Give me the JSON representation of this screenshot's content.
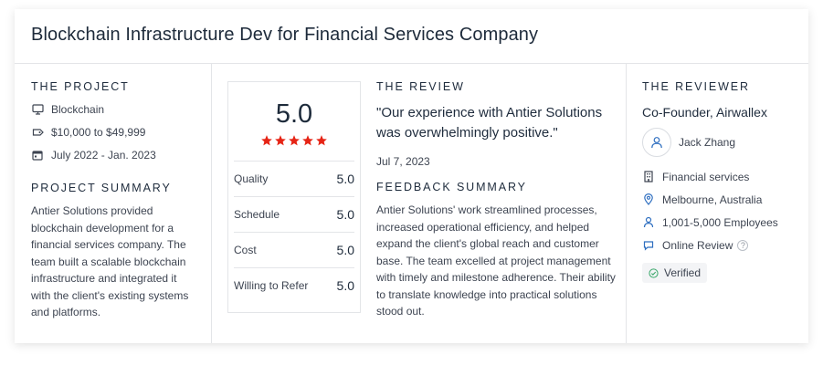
{
  "title": "Blockchain Infrastructure Dev for Financial Services Company",
  "project": {
    "heading": "THE PROJECT",
    "category": "Blockchain",
    "budget": "$10,000 to $49,999",
    "dates": "July 2022 - Jan. 2023",
    "summary_heading": "PROJECT SUMMARY",
    "summary": "Antier Solutions provided blockchain development for a financial services company. The team built a scalable blockchain infrastructure and integrated it with the client's existing systems and platforms."
  },
  "ratings": {
    "overall": "5.0",
    "stars": 5,
    "rows": [
      {
        "label": "Quality",
        "value": "5.0"
      },
      {
        "label": "Schedule",
        "value": "5.0"
      },
      {
        "label": "Cost",
        "value": "5.0"
      },
      {
        "label": "Willing to Refer",
        "value": "5.0"
      }
    ]
  },
  "review": {
    "heading": "THE REVIEW",
    "quote": "\"Our experience with Antier Solutions was overwhelmingly positive.\"",
    "date": "Jul 7, 2023",
    "feedback_heading": "FEEDBACK SUMMARY",
    "feedback": "Antier Solutions' work streamlined processes, increased operational efficiency, and helped expand the client's global reach and customer base. The team excelled at project management with timely and milestone adherence. Their ability to translate knowledge into practical solutions stood out."
  },
  "reviewer": {
    "heading": "THE REVIEWER",
    "role": "Co-Founder, Airwallex",
    "name": "Jack Zhang",
    "industry": "Financial services",
    "location": "Melbourne, Australia",
    "size": "1,001-5,000 Employees",
    "review_type": "Online Review",
    "help": "?",
    "verified": "Verified"
  },
  "colors": {
    "star": "#e62415",
    "text": "#3d4451",
    "heading": "#1f2c3d",
    "border": "#e3e5e8"
  },
  "icons": [
    "monitor-icon",
    "tag-icon",
    "calendar-icon",
    "building-icon",
    "location-pin-icon",
    "people-icon",
    "chat-icon",
    "user-icon",
    "check-circle-icon",
    "star-icon"
  ]
}
